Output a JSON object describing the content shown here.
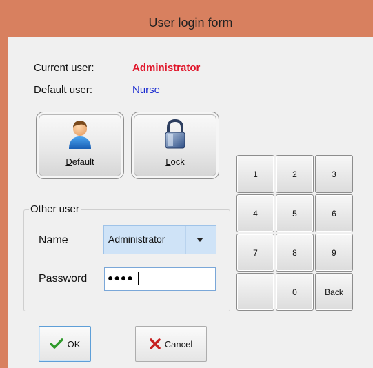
{
  "window": {
    "title": "User login form"
  },
  "labels": {
    "current_user": "Current user:",
    "default_user": "Default user:"
  },
  "values": {
    "current_user": "Administrator",
    "default_user": "Nurse"
  },
  "buttons": {
    "default": {
      "pre": "",
      "accel": "D",
      "post": "efault"
    },
    "lock": {
      "pre": "",
      "accel": "L",
      "post": "ock"
    },
    "ok": "OK",
    "cancel": "Cancel"
  },
  "other_user": {
    "legend": "Other user",
    "name_label": "Name",
    "name_value": "Administrator",
    "password_label": "Password",
    "password_mask": "●●●●"
  },
  "keypad": [
    "1",
    "2",
    "3",
    "4",
    "5",
    "6",
    "7",
    "8",
    "9",
    "",
    "0",
    "Back"
  ],
  "colors": {
    "frame": "#d8805f",
    "current_user_value": "#e0162b",
    "default_user_value": "#1a2bd0"
  }
}
